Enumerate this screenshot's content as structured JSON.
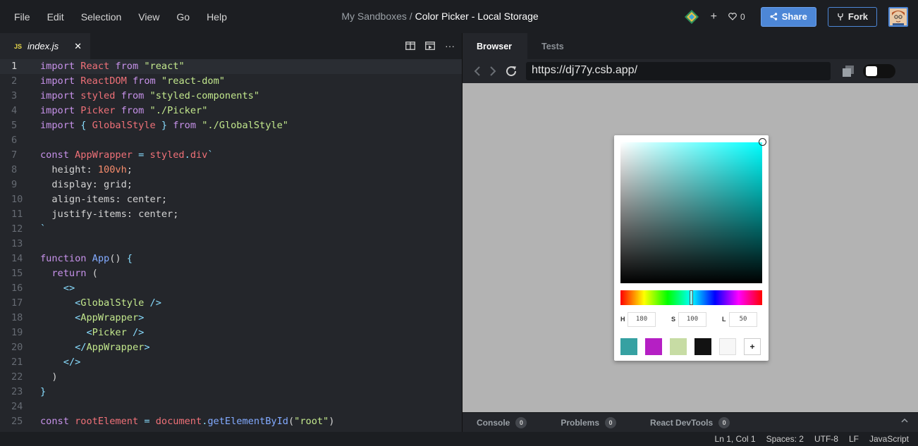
{
  "menu": [
    "File",
    "Edit",
    "Selection",
    "View",
    "Go",
    "Help"
  ],
  "title": {
    "prefix": "My Sandboxes /",
    "name": "Color Picker - Local Storage"
  },
  "actions": {
    "plus": "+",
    "likes": "0",
    "share": "Share",
    "fork": "Fork"
  },
  "editor": {
    "tab": {
      "badge": "JS",
      "name": "index.js",
      "close": "✕"
    },
    "more": "···"
  },
  "code_lines": [
    "import React from \"react\"",
    "import ReactDOM from \"react-dom\"",
    "import styled from \"styled-components\"",
    "import Picker from \"./Picker\"",
    "import { GlobalStyle } from \"./GlobalStyle\"",
    "",
    "const AppWrapper = styled.div`",
    "  height: 100vh;",
    "  display: grid;",
    "  align-items: center;",
    "  justify-items: center;",
    "`",
    "",
    "function App() {",
    "  return (",
    "    <>",
    "      <GlobalStyle />",
    "      <AppWrapper>",
    "        <Picker />",
    "      </AppWrapper>",
    "    </>",
    "  )",
    "}",
    "",
    "const rootElement = document.getElementById(\"root\")"
  ],
  "preview": {
    "tabs": [
      "Browser",
      "Tests"
    ],
    "url": "https://dj77y.csb.app/",
    "picker": {
      "hsl": [
        {
          "label": "H",
          "value": "180"
        },
        {
          "label": "S",
          "value": "100"
        },
        {
          "label": "L",
          "value": "50"
        }
      ],
      "hue_fraction": 0.5,
      "swatches": [
        "#36a1a2",
        "#b51fc4",
        "#c7dca4",
        "#121212",
        "#f7f7f7"
      ],
      "add": "+"
    },
    "console_tabs": [
      {
        "label": "Console",
        "count": "0"
      },
      {
        "label": "Problems",
        "count": "0"
      },
      {
        "label": "React DevTools",
        "count": "0"
      }
    ]
  },
  "status": [
    "Ln 1, Col 1",
    "Spaces: 2",
    "UTF-8",
    "LF",
    "JavaScript"
  ],
  "colors": {
    "accent": "#4d87d7",
    "editor_bg": "#24262b",
    "preview_bg": "#b3b3b3"
  }
}
